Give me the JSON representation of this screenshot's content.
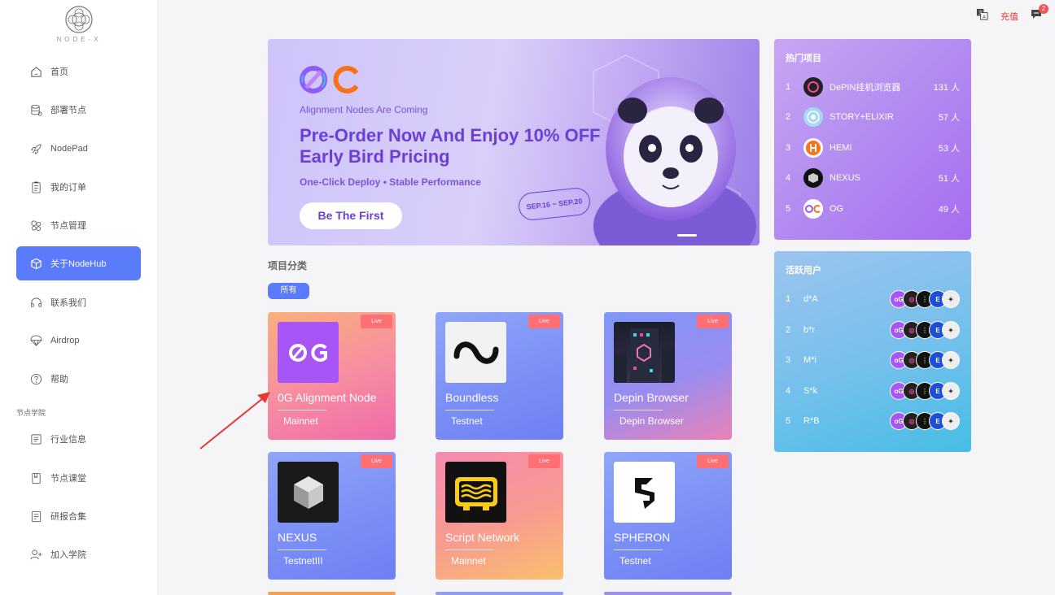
{
  "brand": {
    "logo_text": "NODE-X"
  },
  "sidebar": {
    "items": [
      {
        "label": "首页",
        "icon": "home-icon"
      },
      {
        "label": "部署节点",
        "icon": "database-icon"
      },
      {
        "label": "NodePad",
        "icon": "rocket-icon"
      },
      {
        "label": "我的订单",
        "icon": "clipboard-icon"
      },
      {
        "label": "节点管理",
        "icon": "cluster-icon"
      },
      {
        "label": "关于NodeHub",
        "icon": "cube-icon"
      },
      {
        "label": "联系我们",
        "icon": "headset-icon"
      },
      {
        "label": "Airdrop",
        "icon": "parachute-icon"
      },
      {
        "label": "帮助",
        "icon": "question-icon"
      }
    ],
    "section_label": "节点学院",
    "academy_items": [
      {
        "label": "行业信息",
        "icon": "document-icon"
      },
      {
        "label": "节点课堂",
        "icon": "book-icon"
      },
      {
        "label": "研报合集",
        "icon": "report-icon"
      },
      {
        "label": "加入学院",
        "icon": "add-user-icon"
      }
    ]
  },
  "topbar": {
    "recharge": "充值",
    "notification_count": "2"
  },
  "banner": {
    "subtitle": "Alignment Nodes Are Coming",
    "headline": "Pre-Order Now And Enjoy 10% OFF Early Bird Pricing",
    "tagline": "One-Click Deploy  •  Stable Performance",
    "cta": "Be The First",
    "date": "SEP.16 ~ SEP.20"
  },
  "categories": {
    "title": "项目分类",
    "filters": [
      "所有"
    ]
  },
  "projects": [
    {
      "name": "0G Alignment Node",
      "network": "Mainnet",
      "badge": "Live"
    },
    {
      "name": "Boundless",
      "network": "Testnet",
      "badge": "Live"
    },
    {
      "name": "Depin Browser",
      "network": "Depin Browser",
      "badge": "Live"
    },
    {
      "name": "NEXUS",
      "network": "TestnetIII",
      "badge": "Live"
    },
    {
      "name": "Script Network",
      "network": "Mainnet",
      "badge": "Live"
    },
    {
      "name": "SPHERON",
      "network": "Testnet",
      "badge": "Live"
    }
  ],
  "hot_projects": {
    "title": "热门项目",
    "rows": [
      {
        "rank": "1",
        "name": "DePIN挂机浏览器",
        "count": "131 人"
      },
      {
        "rank": "2",
        "name": "STORY+ELIXIR",
        "count": "57 人"
      },
      {
        "rank": "3",
        "name": "HEMI",
        "count": "53 人"
      },
      {
        "rank": "4",
        "name": "NEXUS",
        "count": "51 人"
      },
      {
        "rank": "5",
        "name": "OG",
        "count": "49 人"
      }
    ]
  },
  "active_users": {
    "title": "活跃用户",
    "rows": [
      {
        "rank": "1",
        "name": "d*A"
      },
      {
        "rank": "2",
        "name": "b*r"
      },
      {
        "rank": "3",
        "name": "M*i"
      },
      {
        "rank": "4",
        "name": "S*k"
      },
      {
        "rank": "5",
        "name": "R*B"
      }
    ]
  },
  "colors": {
    "accent": "#5b7cfa",
    "live": "#ff6f73",
    "recharge": "#e53935"
  }
}
